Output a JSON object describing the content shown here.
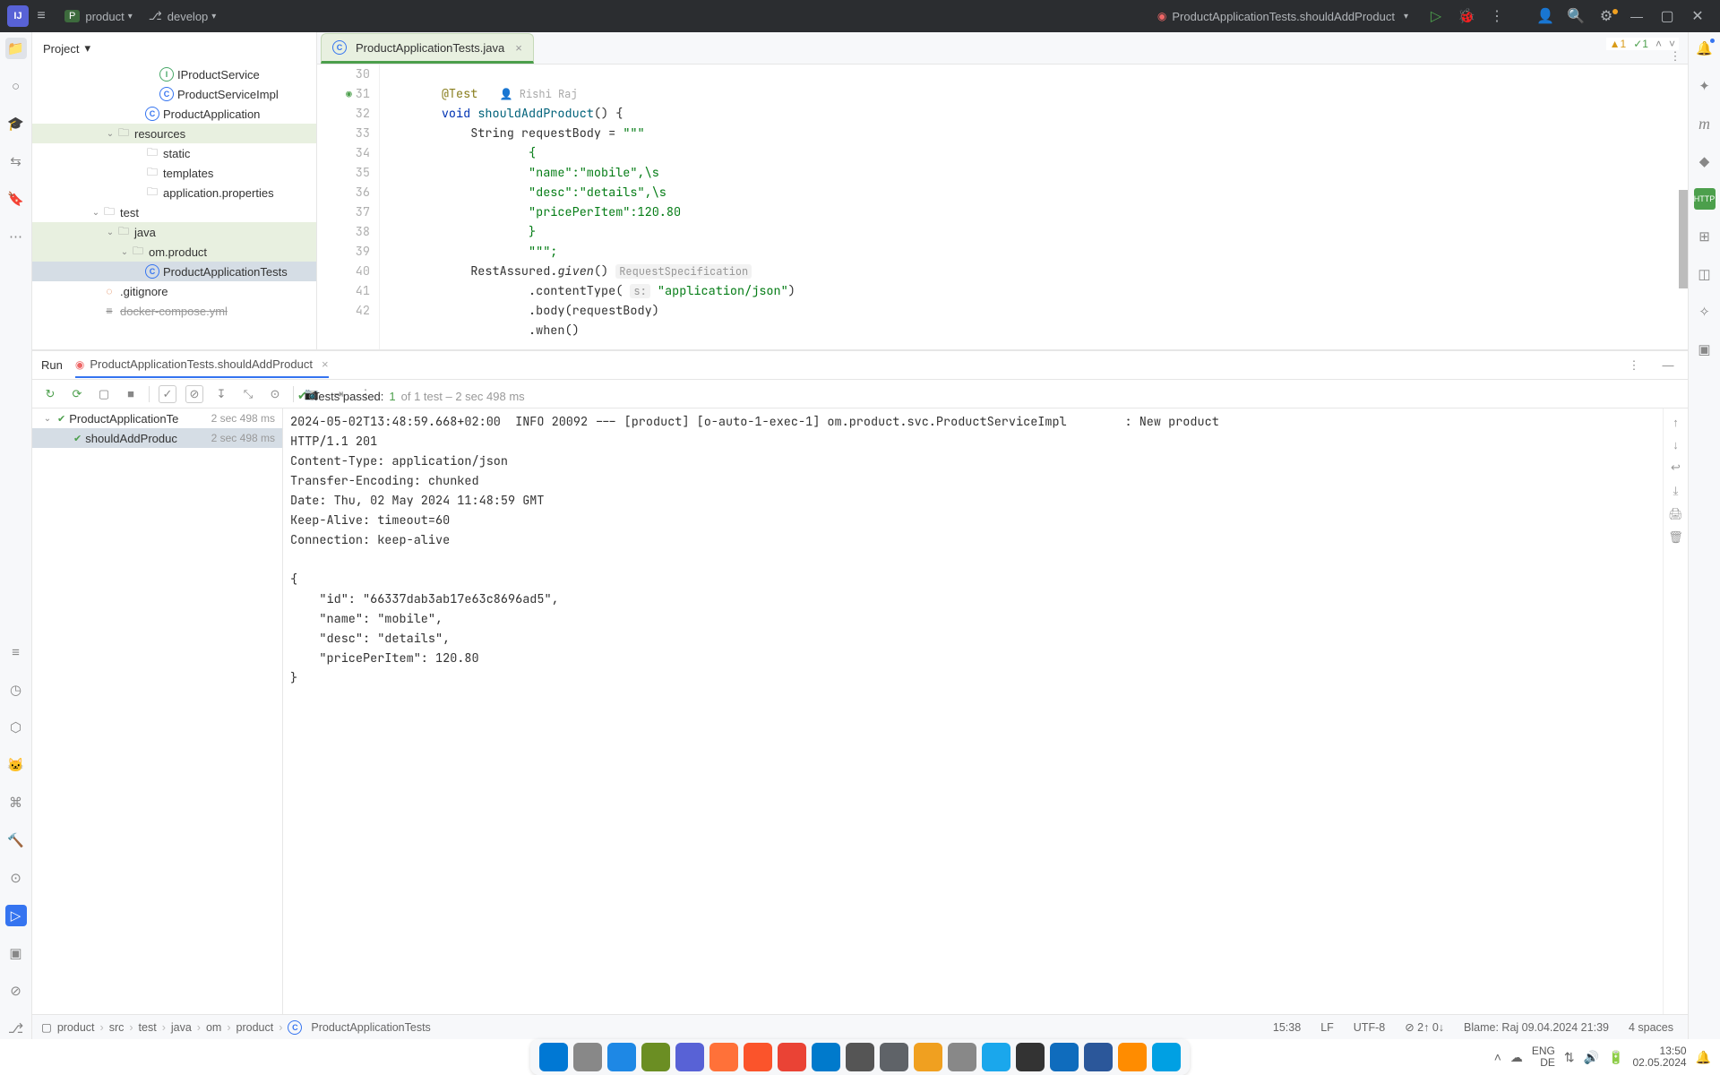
{
  "titlebar": {
    "project_badge": "P",
    "project_name": "product",
    "branch": "develop",
    "run_target": "ProductApplicationTests.shouldAddProduct"
  },
  "project_panel": {
    "title": "Project",
    "tree": [
      {
        "depth": 8,
        "icon": "int",
        "label": "IProductService"
      },
      {
        "depth": 8,
        "icon": "cls",
        "label": "ProductServiceImpl"
      },
      {
        "depth": 7,
        "icon": "cls",
        "label": "ProductApplication"
      },
      {
        "depth": 5,
        "tw": "v",
        "icon": "folder",
        "label": "resources",
        "hl": true
      },
      {
        "depth": 7,
        "icon": "folder",
        "label": "static"
      },
      {
        "depth": 7,
        "icon": "folder",
        "label": "templates"
      },
      {
        "depth": 7,
        "icon": "gear",
        "label": "application.properties"
      },
      {
        "depth": 4,
        "tw": "v",
        "icon": "folder",
        "label": "test"
      },
      {
        "depth": 5,
        "tw": "v",
        "icon": "folder",
        "label": "java",
        "hl": true
      },
      {
        "depth": 6,
        "tw": "v",
        "icon": "folder",
        "label": "om.product",
        "hl": true
      },
      {
        "depth": 7,
        "icon": "cls",
        "label": "ProductApplicationTests",
        "sel": true
      },
      {
        "depth": 4,
        "icon": "git",
        "label": ".gitignore"
      },
      {
        "depth": 4,
        "icon": "yml",
        "label": "docker-compose.yml"
      }
    ]
  },
  "editor": {
    "tab": {
      "label": "ProductApplicationTests.java"
    },
    "badges": {
      "warn": "1",
      "ok": "1"
    },
    "author": "Rishi Raj",
    "lines": [
      30,
      31,
      32,
      33,
      34,
      35,
      36,
      37,
      38,
      39,
      40,
      41,
      42
    ],
    "code": {
      "l30": "@Test",
      "l31_kw": "void ",
      "l31_m": "shouldAddProduct",
      "l31_p": "() {",
      "l32_a": "String requestBody = ",
      "l32_b": "\"\"\"",
      "l33": "{",
      "l34": "\"name\":\"mobile\",\\s",
      "l35": "\"desc\":\"details\",\\s",
      "l36": "\"pricePerItem\":120.80",
      "l37": "}",
      "l38": "\"\"\";",
      "l39_a": "RestAssured.",
      "l39_b": "given",
      "l39_c": "()",
      "l39_hint": "RequestSpecification",
      "l40_a": ".contentType( ",
      "l40_h": "s:",
      "l40_b": "\"application/json\"",
      "l40_c": ")",
      "l41": ".body(requestBody)",
      "l42": ".when()"
    }
  },
  "run": {
    "tab_label": "Run",
    "config": "ProductApplicationTests.shouldAddProduct",
    "summary": {
      "prefix": "Tests passed: ",
      "passed": "1",
      "rest": " of 1 test – 2 sec 498 ms"
    },
    "tree": [
      {
        "depth": 0,
        "tw": "v",
        "label": "ProductApplicationTe",
        "dur": "2 sec 498 ms"
      },
      {
        "depth": 1,
        "label": "shouldAddProduc",
        "dur": "2 sec 498 ms",
        "sel": true
      }
    ],
    "console": "2024-05-02T13:48:59.668+02:00  INFO 20092 --- [product] [o-auto-1-exec-1] om.product.svc.ProductServiceImpl        : New product\nHTTP/1.1 201 \nContent-Type: application/json\nTransfer-Encoding: chunked\nDate: Thu, 02 May 2024 11:48:59 GMT\nKeep-Alive: timeout=60\nConnection: keep-alive\n\n{\n    \"id\": \"66337dab3ab17e63c8696ad5\",\n    \"name\": \"mobile\",\n    \"desc\": \"details\",\n    \"pricePerItem\": 120.80\n}\n"
  },
  "statusbar": {
    "breadcrumbs": [
      "product",
      "src",
      "test",
      "java",
      "om",
      "product",
      "ProductApplicationTests"
    ],
    "caret": "15:38",
    "line_sep": "LF",
    "encoding": "UTF-8",
    "git_changes": "2↑ 0↓",
    "blame": "Blame: Raj 09.04.2024 21:39",
    "indent": "4 spaces"
  },
  "systray": {
    "lang1": "ENG",
    "lang2": "DE",
    "time": "13:50",
    "date": "02.05.2024"
  },
  "taskbar_apps": [
    "#0078d4",
    "#888",
    "#1e88e5",
    "#6b8e23",
    "#5862d6",
    "#ff7139",
    "#fb542b",
    "#ea4335",
    "#007acc",
    "#555",
    "#5f6368",
    "#f0a020",
    "#888",
    "#1aa7ec",
    "#333",
    "#0f6cbd",
    "#2b579a",
    "#ff8c00",
    "#00a0e3"
  ]
}
